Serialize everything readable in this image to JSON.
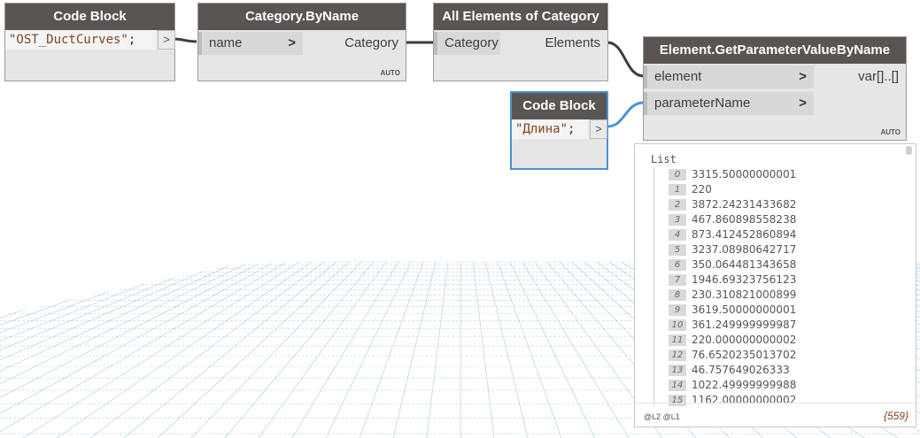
{
  "colors": {
    "header": "#5a5552",
    "node_body": "#e6e6e6",
    "wire": "#3e3e3e",
    "wire_selected": "#4a90d9",
    "grid": "#6a9fc4",
    "selection": "#4a90d9"
  },
  "nodes": {
    "code_block_1": {
      "title": "Code Block",
      "code": "\"OST_DuctCurves\"",
      "semicolon": ";",
      "out_symbol": ">"
    },
    "category_by_name": {
      "title": "Category.ByName",
      "input": "name",
      "input_arrow": ">",
      "output": "Category",
      "lacing": "AUTO"
    },
    "all_elements": {
      "title": "All Elements of Category",
      "input": "Category",
      "output": "Elements"
    },
    "get_param": {
      "title": "Element.GetParameterValueByName",
      "input_1": "element",
      "input_2": "parameterName",
      "input_arrow": ">",
      "output": "var[]..[]",
      "lacing": "AUTO"
    },
    "code_block_2": {
      "title": "Code Block",
      "code": "\"Длина\"",
      "semicolon": ";",
      "out_symbol": ">"
    }
  },
  "watch": {
    "title": "List",
    "items": [
      {
        "index": "0",
        "value": "3315.50000000001"
      },
      {
        "index": "1",
        "value": "220"
      },
      {
        "index": "2",
        "value": "3872.24231433682"
      },
      {
        "index": "3",
        "value": "467.860898558238"
      },
      {
        "index": "4",
        "value": "873.412452860894"
      },
      {
        "index": "5",
        "value": "3237.08980642717"
      },
      {
        "index": "6",
        "value": "350.064481343658"
      },
      {
        "index": "7",
        "value": "1946.69323756123"
      },
      {
        "index": "8",
        "value": "230.310821000899"
      },
      {
        "index": "9",
        "value": "3619.50000000001"
      },
      {
        "index": "10",
        "value": "361.249999999987"
      },
      {
        "index": "11",
        "value": "220.000000000002"
      },
      {
        "index": "12",
        "value": "76.6520235013702"
      },
      {
        "index": "13",
        "value": "46.757649026333"
      },
      {
        "index": "14",
        "value": "1022.49999999988"
      },
      {
        "index": "15",
        "value": "1162.00000000002"
      }
    ],
    "levels": "@L2 @L1",
    "count": "{559}"
  }
}
